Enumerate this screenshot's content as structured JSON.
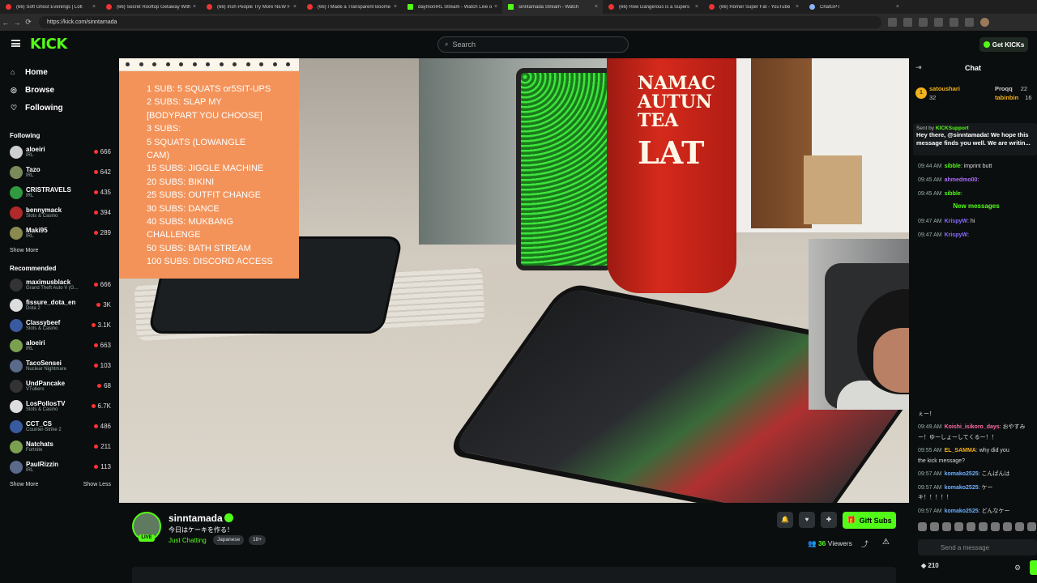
{
  "browser": {
    "tabs": [
      {
        "label": "(66) Soft Ghost Evenings | Lofi",
        "icon": "youtube-icon"
      },
      {
        "label": "(66) Secret Rooftop Getaway With",
        "icon": "youtube-icon"
      },
      {
        "label": "(66) Irish People Try More NEW F",
        "icon": "youtube-icon"
      },
      {
        "label": "(66) I Made a Transparent Boome",
        "icon": "youtube-icon"
      },
      {
        "label": "daymonIRL Stream - Watch Live o",
        "icon": "kick-icon"
      },
      {
        "label": "sinntamada Stream - Watch",
        "icon": "kick-icon"
      },
      {
        "label": "(66) How Dangerous is a Supers",
        "icon": "youtube-icon"
      },
      {
        "label": "(66) Homer Super Fat - YouTube",
        "icon": "youtube-icon"
      },
      {
        "label": "ChatGPT",
        "icon": "chatgpt-icon"
      }
    ],
    "url": "https://kick.com/sinntamada"
  },
  "header": {
    "logo": "KICK",
    "search_placeholder": "Search",
    "get_kicks": "Get KICKs"
  },
  "sidebar": {
    "nav": [
      {
        "label": "Home",
        "icon": "home-icon"
      },
      {
        "label": "Browse",
        "icon": "compass-icon"
      },
      {
        "label": "Following",
        "icon": "heart-icon"
      }
    ],
    "following_title": "Following",
    "following": [
      {
        "name": "aloeiri",
        "category": "IRL",
        "viewers": "666"
      },
      {
        "name": "Tazo",
        "category": "IRL",
        "viewers": "642"
      },
      {
        "name": "CRISTRAVELS",
        "category": "IRL",
        "viewers": "435"
      },
      {
        "name": "bennymack",
        "category": "Slots & Casino",
        "viewers": "394"
      },
      {
        "name": "Maki95",
        "category": "IRL",
        "viewers": "289"
      }
    ],
    "show_more": "Show More",
    "recommended_title": "Recommended",
    "recommended": [
      {
        "name": "maximusblack",
        "category": "Grand Theft Auto V (G...",
        "viewers": "666"
      },
      {
        "name": "fissure_dota_en",
        "category": "Dota 2",
        "viewers": "3K"
      },
      {
        "name": "Classybeef",
        "category": "Slots & Casino",
        "viewers": "3.1K"
      },
      {
        "name": "aloeiri",
        "category": "IRL",
        "viewers": "663"
      },
      {
        "name": "TacoSensei",
        "category": "Nuclear Nightmare",
        "viewers": "103"
      },
      {
        "name": "UndPancake",
        "category": "VTubers",
        "viewers": "68"
      },
      {
        "name": "LosPollosTV",
        "category": "Slots & Casino",
        "viewers": "6.7K"
      },
      {
        "name": "CCT_CS",
        "category": "Counter-Strike 2",
        "viewers": "486"
      },
      {
        "name": "Natchats",
        "category": "Fortnite",
        "viewers": "211"
      },
      {
        "name": "PaulRizzin",
        "category": "IRL",
        "viewers": "113"
      }
    ],
    "show_more_2": "Show More",
    "show_less": "Show Less"
  },
  "overlay": {
    "lines": [
      "1 SUB: 5 SQUATS or5SIT-UPS",
      "2 SUBS: SLAP MY",
      "[BODYPART YOU CHOOSE]",
      "3 SUBS:",
      "5    SQUATS    (LOWANGLE",
      "CAM)",
      "15 SUBS: JIGGLE MACHINE",
      "20 SUBS: BIKINI",
      "25 SUBS: OUTFIT CHANGE",
      "30 SUBS: DANCE",
      "40 SUBS: MUKBANG",
      "CHALLENGE",
      "50 SUBS: BATH STREAM",
      "100 SUBS: DISCORD ACCESS"
    ]
  },
  "video": {
    "can_text_1": "NAMAC",
    "can_text_2": "AUTUN",
    "can_text_3": "TEA",
    "can_text_big": "LAT"
  },
  "stream": {
    "streamer": "sinntamada",
    "live_label": "LIVE",
    "title": "今日はケーキを作る！",
    "category": "Just Chatting",
    "tags": [
      "Japanese",
      "18+"
    ],
    "gift_subs": "Gift Subs",
    "viewers_count": "36",
    "viewers_label": "Viewers"
  },
  "chat": {
    "title": "Chat",
    "top_gifters": [
      {
        "name": "satoushari",
        "count": "32"
      },
      {
        "name": "Proqq",
        "count": "22"
      },
      {
        "name": "tabinbin",
        "count": "16"
      }
    ],
    "pinned_sender": "KICKSupport",
    "pinned_prefix": "Sent by",
    "pinned_text_1": "Hey there, @sinntamada! We hope this",
    "pinned_text_2": "message finds you well. We are writin...",
    "new_messages": "New messages",
    "messages": [
      {
        "time": "09:44 AM",
        "user": "sibble",
        "text": "imprint butt",
        "color": "#53fc18"
      },
      {
        "time": "09:45 AM",
        "user": "ahmedmo00",
        "text": "",
        "color": "#b06cff"
      },
      {
        "time": "09:45 AM",
        "user": "sibble",
        "text": "",
        "color": "#53fc18"
      },
      {
        "time": "09:47 AM",
        "user": "KrispyW",
        "text": "hi",
        "color": "#8a6cff"
      },
      {
        "time": "09:47 AM",
        "user": "KrispyW",
        "text": "",
        "color": "#8a6cff"
      },
      {
        "time": "",
        "user": "",
        "text": "ぇー！",
        "color": "#ddd"
      },
      {
        "time": "09:49 AM",
        "user": "Koishi_isikoro_days",
        "text": "おやすみ",
        "color": "#ff6ca6"
      },
      {
        "time": "",
        "user": "",
        "text": "ー！ゆーしょーしてくるー！！",
        "color": "#ddd"
      },
      {
        "time": "09:55 AM",
        "user": "EL_SAMMA",
        "text": "why did you",
        "color": "#f3b21b"
      },
      {
        "time": "",
        "user": "",
        "text": "the kick message?",
        "color": "#ddd"
      },
      {
        "time": "09:57 AM",
        "user": "komako2525",
        "text": "こんばんは",
        "color": "#6cb0ff"
      },
      {
        "time": "09:57 AM",
        "user": "komako2525",
        "text": "ケー",
        "color": "#6cb0ff"
      },
      {
        "time": "",
        "user": "",
        "text": "キ！！！！！",
        "color": "#ddd"
      },
      {
        "time": "09:57 AM",
        "user": "komako2525",
        "text": "どんなケー",
        "color": "#6cb0ff"
      }
    ],
    "send_placeholder": "Send a message",
    "points": "210"
  }
}
